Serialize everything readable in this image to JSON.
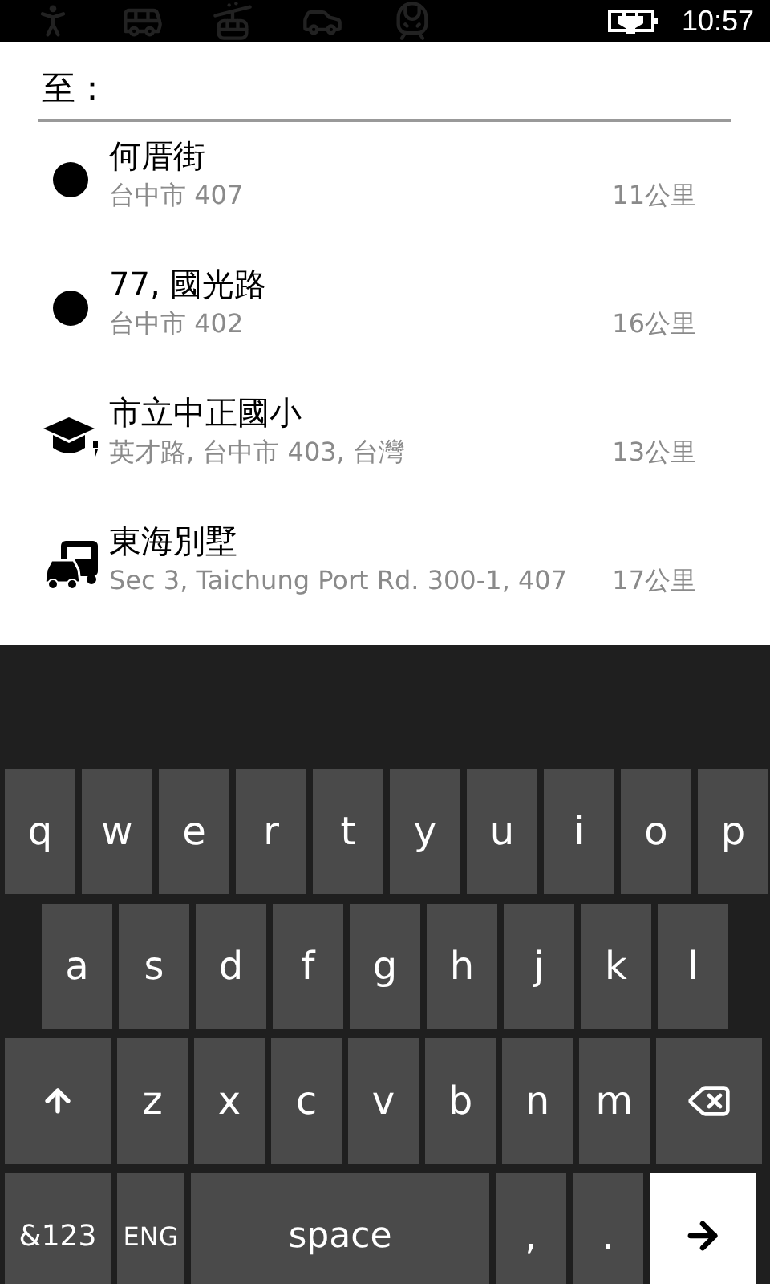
{
  "status_bar": {
    "time": "10:57",
    "charging": true
  },
  "destination": {
    "label": "至："
  },
  "results": [
    {
      "kind": "dot",
      "name": "何厝街",
      "address": "台中市 407",
      "distance": "11公里"
    },
    {
      "kind": "dot",
      "name": "77, 國光路",
      "address": "台中市 402",
      "distance": "16公里"
    },
    {
      "kind": "school",
      "name": "市立中正國小",
      "address": "英才路, 台中市 403, 台灣",
      "distance": "13公里"
    },
    {
      "kind": "vehicle",
      "name": "東海別墅",
      "address": "Sec 3, Taichung Port Rd. 300-1, 407",
      "distance": "17公里"
    }
  ],
  "keyboard": {
    "rows": [
      {
        "keys": [
          {
            "kind": "char",
            "label": "q"
          },
          {
            "kind": "char",
            "label": "w"
          },
          {
            "kind": "char",
            "label": "e"
          },
          {
            "kind": "char",
            "label": "r"
          },
          {
            "kind": "char",
            "label": "t"
          },
          {
            "kind": "char",
            "label": "y"
          },
          {
            "kind": "char",
            "label": "u"
          },
          {
            "kind": "char",
            "label": "i"
          },
          {
            "kind": "char",
            "label": "o"
          },
          {
            "kind": "char",
            "label": "p"
          }
        ]
      },
      {
        "keys": [
          {
            "kind": "char",
            "label": "a"
          },
          {
            "kind": "char",
            "label": "s"
          },
          {
            "kind": "char",
            "label": "d"
          },
          {
            "kind": "char",
            "label": "f"
          },
          {
            "kind": "char",
            "label": "g"
          },
          {
            "kind": "char",
            "label": "h"
          },
          {
            "kind": "char",
            "label": "j"
          },
          {
            "kind": "char",
            "label": "k"
          },
          {
            "kind": "char",
            "label": "l"
          }
        ]
      },
      {
        "keys": [
          {
            "kind": "shift"
          },
          {
            "kind": "char",
            "label": "z"
          },
          {
            "kind": "char",
            "label": "x"
          },
          {
            "kind": "char",
            "label": "c"
          },
          {
            "kind": "char",
            "label": "v"
          },
          {
            "kind": "char",
            "label": "b"
          },
          {
            "kind": "char",
            "label": "n"
          },
          {
            "kind": "char",
            "label": "m"
          },
          {
            "kind": "backspace"
          }
        ]
      },
      {
        "keys": [
          {
            "kind": "symbols",
            "label": "&123"
          },
          {
            "kind": "lang",
            "label": "ENG"
          },
          {
            "kind": "space",
            "label": "space"
          },
          {
            "kind": "char",
            "label": ","
          },
          {
            "kind": "char",
            "label": "."
          },
          {
            "kind": "enter"
          }
        ]
      }
    ]
  }
}
